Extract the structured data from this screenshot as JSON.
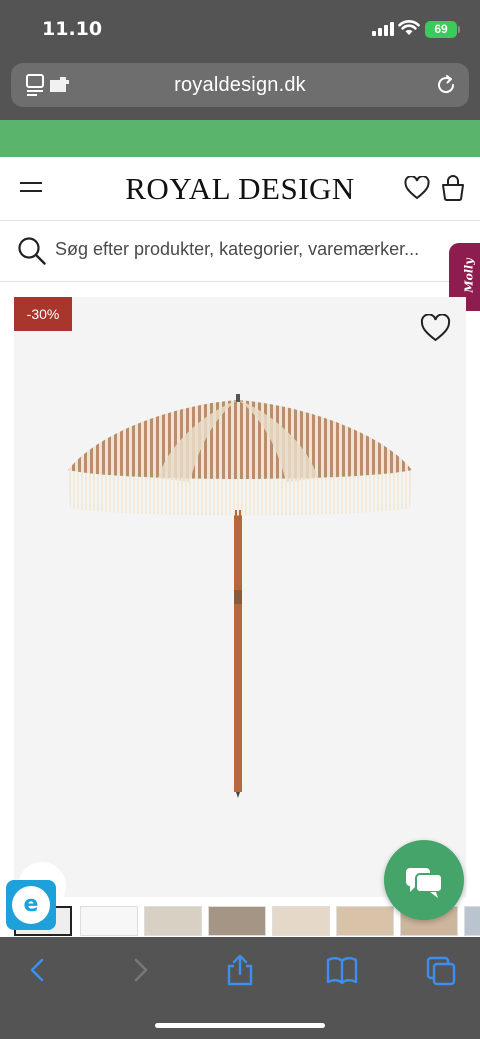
{
  "status_bar": {
    "time": "11.10",
    "battery": "69"
  },
  "browser": {
    "url": "royaldesign.dk"
  },
  "site": {
    "logo": "ROYAL DESIGN",
    "search_placeholder": "Søg efter produkter, kategorier, varemærker...",
    "chat_widget_label": "Molly"
  },
  "product": {
    "discount_badge": "-30%",
    "thumbnails_count": 8
  },
  "accessibility": {
    "badge_letter": "e"
  },
  "colors": {
    "promo_bar": "#5ab46b",
    "discount_badge": "#a9362c",
    "chat_button": "#44a46a",
    "molly_tab": "#8c1d4e",
    "accessibility_button": "#1ea0db",
    "browser_chrome": "#545454"
  },
  "icons": {
    "header": [
      "hamburger-menu-icon",
      "heart-icon",
      "shopping-bag-icon"
    ],
    "search": "search-icon",
    "toolbar": [
      "back-icon",
      "forward-icon",
      "share-icon",
      "bookmarks-icon",
      "tabs-icon"
    ]
  }
}
